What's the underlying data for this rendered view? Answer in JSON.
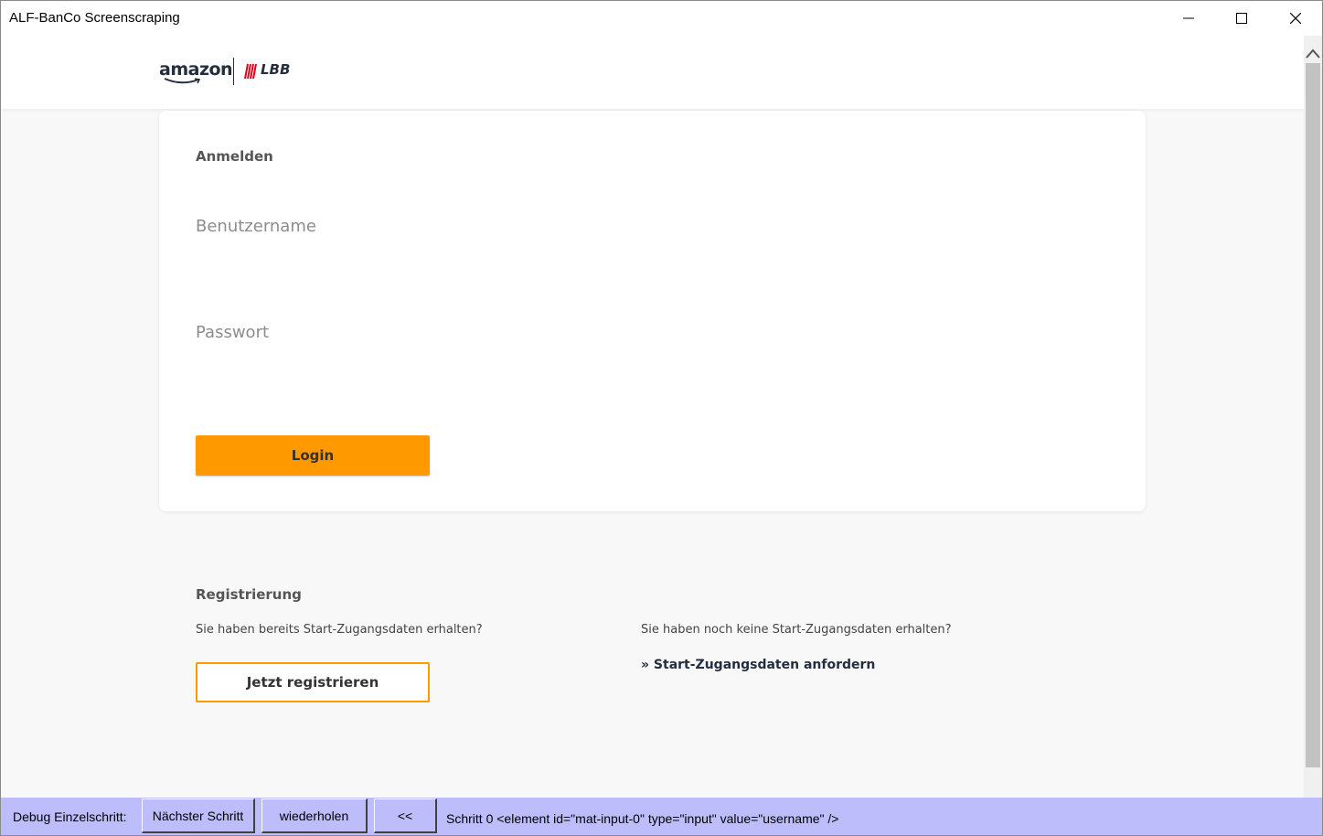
{
  "window": {
    "title": "ALF-BanCo Screenscraping",
    "controls": {
      "minimize": "minimize-icon",
      "maximize": "maximize-icon",
      "close": "close-icon"
    }
  },
  "header": {
    "logo_left": "amazon",
    "logo_right": "LBB"
  },
  "login": {
    "title": "Anmelden",
    "username_label": "Benutzername",
    "password_label": "Passwort",
    "button_label": "Login"
  },
  "registration": {
    "title": "Registrierung",
    "left_text": "Sie haben bereits Start-Zugangsdaten erhalten?",
    "register_button": "Jetzt registrieren",
    "right_text": "Sie haben noch keine Start-Zugangsdaten erhalten?",
    "request_link": "» Start-Zugangsdaten anfordern"
  },
  "debug": {
    "label": "Debug Einzelschritt:",
    "next_button": "Nächster Schritt",
    "repeat_button": "wiederholen",
    "back_button": "<<",
    "status": "Schritt 0 <element id=\"mat-input-0\" type=\"input\" value=\"username\" />"
  },
  "colors": {
    "accent": "#ff9900",
    "debug_bar": "#bdbdfc",
    "text_dark": "#232f3e"
  }
}
